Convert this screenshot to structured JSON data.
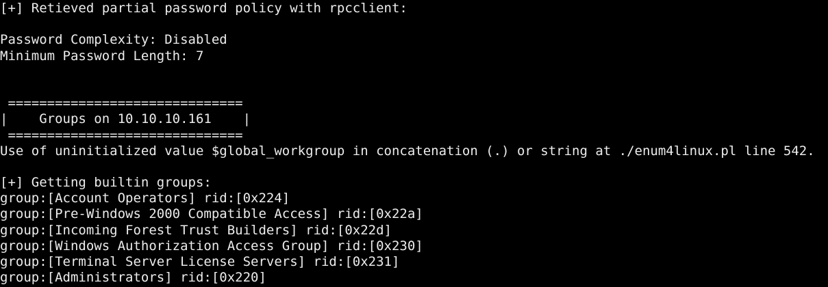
{
  "terminal": {
    "background": "#000000",
    "foreground": "#ececec",
    "lines": [
      "[+] Retieved partial password policy with rpcclient:",
      "",
      "Password Complexity: Disabled",
      "Minimum Password Length: 7",
      "",
      "",
      " ==============================",
      "|    Groups on 10.10.10.161    |",
      " ==============================",
      "Use of uninitialized value $global_workgroup in concatenation (.) or string at ./enum4linux.pl line 542.",
      "",
      "[+] Getting builtin groups:",
      "group:[Account Operators] rid:[0x224]",
      "group:[Pre-Windows 2000 Compatible Access] rid:[0x22a]",
      "group:[Incoming Forest Trust Builders] rid:[0x22d]",
      "group:[Windows Authorization Access Group] rid:[0x230]",
      "group:[Terminal Server License Servers] rid:[0x231]",
      "group:[Administrators] rid:[0x220]"
    ]
  }
}
